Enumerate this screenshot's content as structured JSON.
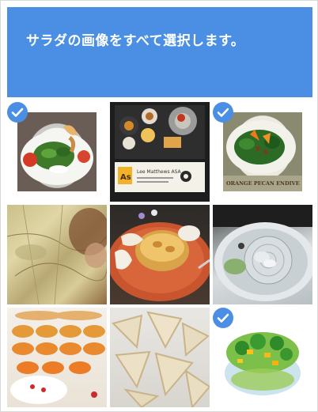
{
  "banner": {
    "instruction": "サラダの画像をすべて選択します。",
    "accent_color": "#4a8fe3"
  },
  "tiles": [
    {
      "name": "salad-with-tomatoes",
      "selected": true
    },
    {
      "name": "lunch-tray-with-label",
      "selected": false,
      "label_logo": "As",
      "label_text": "Lee Matthews ASA"
    },
    {
      "name": "orange-pecan-salad",
      "selected": true,
      "caption": "ORANGE PECAN ENDIVE"
    },
    {
      "name": "old-map",
      "selected": false
    },
    {
      "name": "quiche-plate",
      "selected": false
    },
    {
      "name": "fish-plate",
      "selected": false
    },
    {
      "name": "tarts-display",
      "selected": false
    },
    {
      "name": "bread-slices",
      "selected": false
    },
    {
      "name": "salad-bowl",
      "selected": true
    }
  ]
}
